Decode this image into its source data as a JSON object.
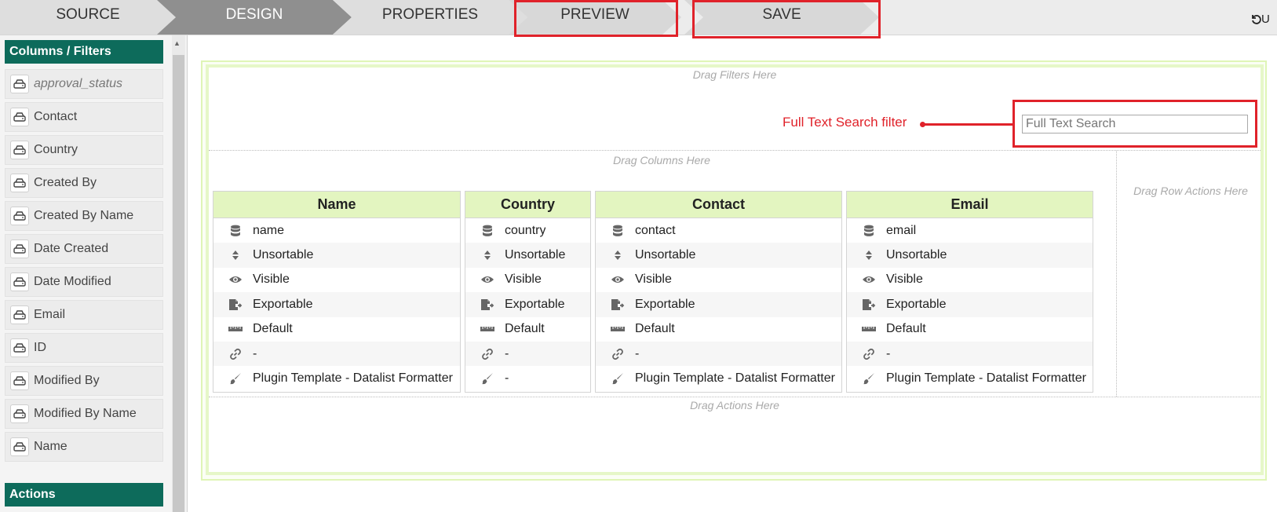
{
  "tabs": [
    {
      "label": "SOURCE"
    },
    {
      "label": "DESIGN"
    },
    {
      "label": "PROPERTIES"
    },
    {
      "label": "PREVIEW"
    },
    {
      "label": "SAVE"
    }
  ],
  "undo_label": "U",
  "sidebar": {
    "columns_header": "Columns / Filters",
    "fields": [
      "approval_status",
      "Contact",
      "Country",
      "Created By",
      "Created By Name",
      "Date Created",
      "Date Modified",
      "Email",
      "ID",
      "Modified By",
      "Modified By Name",
      "Name"
    ],
    "actions_header": "Actions"
  },
  "canvas": {
    "drag_filters": "Drag Filters Here",
    "drag_columns": "Drag Columns Here",
    "drag_row_actions": "Drag Row Actions Here",
    "drag_actions": "Drag Actions Here",
    "search_placeholder": "Full Text Search",
    "annotation": "Full Text Search filter"
  },
  "columns": [
    {
      "title": "Name",
      "rows": [
        "name",
        "Unsortable",
        "Visible",
        "Exportable",
        "Default",
        "-",
        "Plugin Template - Datalist Formatter"
      ]
    },
    {
      "title": "Country",
      "rows": [
        "country",
        "Unsortable",
        "Visible",
        "Exportable",
        "Default",
        "-",
        "-"
      ]
    },
    {
      "title": "Contact",
      "rows": [
        "contact",
        "Unsortable",
        "Visible",
        "Exportable",
        "Default",
        "-",
        "Plugin Template - Datalist Formatter"
      ]
    },
    {
      "title": "Email",
      "rows": [
        "email",
        "Unsortable",
        "Visible",
        "Exportable",
        "Default",
        "-",
        "Plugin Template - Datalist Formatter"
      ]
    }
  ],
  "row_icons": [
    "database-icon",
    "sort-icon",
    "eye-icon",
    "export-icon",
    "ruler-icon",
    "link-icon",
    "brush-icon"
  ],
  "colors": {
    "accent_header": "#0d6b5b",
    "column_header": "#e3f5c0",
    "highlight": "#e0222a",
    "active_tab": "#8f8f8f"
  }
}
